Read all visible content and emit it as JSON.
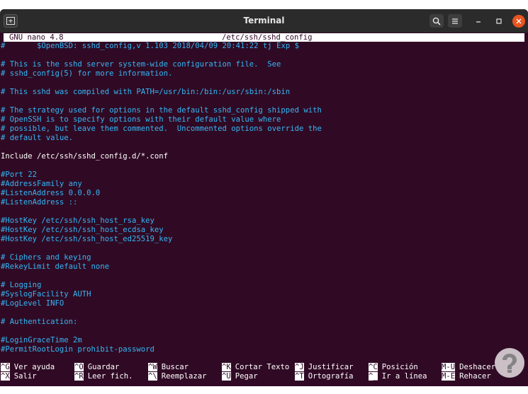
{
  "window": {
    "title": "Terminal",
    "icons": {
      "new_tab": "new-tab-icon",
      "search": "search-icon",
      "menu": "hamburger-menu-icon",
      "minimize": "minimize-icon",
      "maximize": "maximize-icon",
      "close": "close-icon"
    },
    "colors": {
      "background": "#300a24",
      "titlebar": "#2b2b2b",
      "close": "#e95420",
      "comment": "#34b6f5"
    }
  },
  "nano": {
    "version": "GNU nano 4.8",
    "filename": "/etc/ssh/sshd_config"
  },
  "buffer": {
    "lines": [
      {
        "text": "#\t$OpenBSD: sshd_config,v 1.103 2018/04/09 20:41:22 tj Exp $",
        "type": "comment"
      },
      {
        "text": "",
        "type": "blank"
      },
      {
        "text": "# This is the sshd server system-wide configuration file.  See",
        "type": "comment"
      },
      {
        "text": "# sshd_config(5) for more information.",
        "type": "comment"
      },
      {
        "text": "",
        "type": "blank"
      },
      {
        "text": "# This sshd was compiled with PATH=/usr/bin:/bin:/usr/sbin:/sbin",
        "type": "comment"
      },
      {
        "text": "",
        "type": "blank"
      },
      {
        "text": "# The strategy used for options in the default sshd_config shipped with",
        "type": "comment"
      },
      {
        "text": "# OpenSSH is to specify options with their default value where",
        "type": "comment"
      },
      {
        "text": "# possible, but leave them commented.  Uncommented options override the",
        "type": "comment"
      },
      {
        "text": "# default value.",
        "type": "comment"
      },
      {
        "text": "",
        "type": "blank"
      },
      {
        "text": "Include /etc/ssh/sshd_config.d/*.conf",
        "type": "code"
      },
      {
        "text": "",
        "type": "blank"
      },
      {
        "text": "#Port 22",
        "type": "comment"
      },
      {
        "text": "#AddressFamily any",
        "type": "comment"
      },
      {
        "text": "#ListenAddress 0.0.0.0",
        "type": "comment"
      },
      {
        "text": "#ListenAddress ::",
        "type": "comment"
      },
      {
        "text": "",
        "type": "blank"
      },
      {
        "text": "#HostKey /etc/ssh/ssh_host_rsa_key",
        "type": "comment"
      },
      {
        "text": "#HostKey /etc/ssh/ssh_host_ecdsa_key",
        "type": "comment"
      },
      {
        "text": "#HostKey /etc/ssh/ssh_host_ed25519_key",
        "type": "comment"
      },
      {
        "text": "",
        "type": "blank"
      },
      {
        "text": "# Ciphers and keying",
        "type": "comment"
      },
      {
        "text": "#RekeyLimit default none",
        "type": "comment"
      },
      {
        "text": "",
        "type": "blank"
      },
      {
        "text": "# Logging",
        "type": "comment"
      },
      {
        "text": "#SyslogFacility AUTH",
        "type": "comment"
      },
      {
        "text": "#LogLevel INFO",
        "type": "comment"
      },
      {
        "text": "",
        "type": "blank"
      },
      {
        "text": "# Authentication:",
        "type": "comment"
      },
      {
        "text": "",
        "type": "blank"
      },
      {
        "text": "#LoginGraceTime 2m",
        "type": "comment"
      },
      {
        "text": "#PermitRootLogin prohibit-password",
        "type": "comment"
      }
    ]
  },
  "shortcuts": [
    [
      {
        "key": "^G",
        "label": "Ver ayuda"
      },
      {
        "key": "^X",
        "label": "Salir"
      }
    ],
    [
      {
        "key": "^O",
        "label": "Guardar"
      },
      {
        "key": "^R",
        "label": "Leer fich."
      }
    ],
    [
      {
        "key": "^W",
        "label": "Buscar"
      },
      {
        "key": "^\\",
        "label": "Reemplazar"
      }
    ],
    [
      {
        "key": "^K",
        "label": "Cortar Texto"
      },
      {
        "key": "^U",
        "label": "Pegar"
      }
    ],
    [
      {
        "key": "^J",
        "label": "Justificar"
      },
      {
        "key": "^T",
        "label": "Ortografía"
      }
    ],
    [
      {
        "key": "^C",
        "label": "Posición"
      },
      {
        "key": "^_",
        "label": "Ir a línea"
      }
    ],
    [
      {
        "key": "M-U",
        "label": "Deshacer"
      },
      {
        "key": "M-E",
        "label": "Rehacer"
      }
    ]
  ],
  "watermark": {
    "icon": "solvetic-logo-icon"
  }
}
